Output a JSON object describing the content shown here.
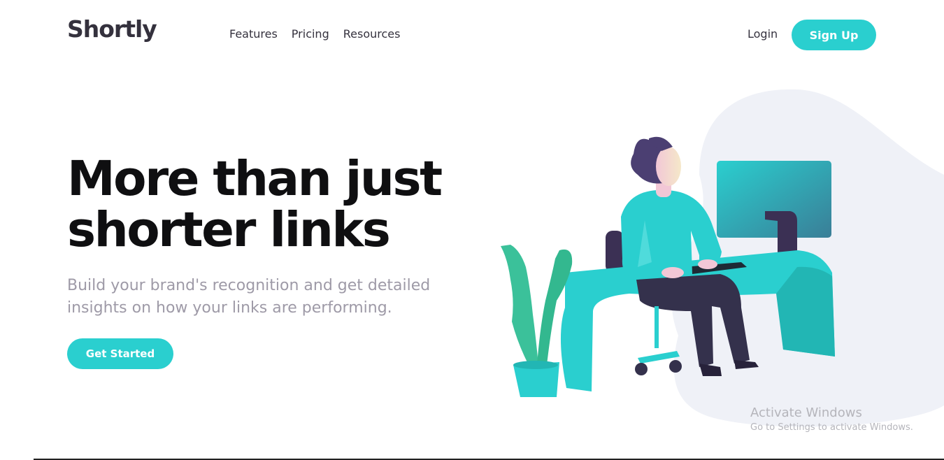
{
  "header": {
    "logo": "Shortly",
    "nav": [
      "Features",
      "Pricing",
      "Resources"
    ],
    "login_label": "Login",
    "signup_label": "Sign Up"
  },
  "hero": {
    "title": "More than just shorter links",
    "subtitle": "Build your brand's recognition and get detailed insights on how your links are performing.",
    "cta_label": "Get Started"
  },
  "watermark": {
    "title": "Activate Windows",
    "subtitle": "Go to Settings to activate Windows."
  },
  "colors": {
    "accent": "#2acfcf",
    "dark_text": "#34313d",
    "gray_text": "#9e9aa7",
    "illustration_bg": "#eff1f7",
    "purple": "#3b3054"
  }
}
